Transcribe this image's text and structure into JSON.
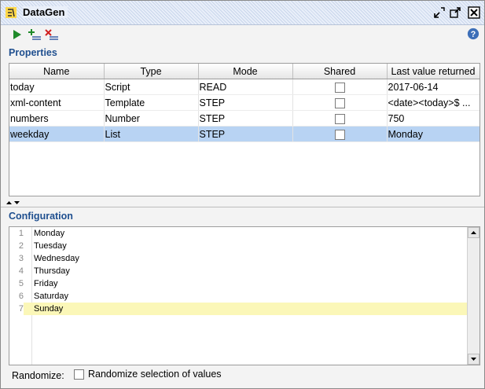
{
  "window": {
    "title": "DataGen"
  },
  "toolbar": {
    "run_icon": "play-icon",
    "add_icon": "add-property-icon",
    "remove_icon": "remove-property-icon",
    "help_icon": "help-icon"
  },
  "properties": {
    "header": "Properties",
    "columns": [
      "Name",
      "Type",
      "Mode",
      "Shared",
      "Last value returned"
    ],
    "rows": [
      {
        "name": "today",
        "type": "Script",
        "mode": "READ",
        "shared": false,
        "last": "2017-06-14"
      },
      {
        "name": "xml-content",
        "type": "Template",
        "mode": "STEP",
        "shared": false,
        "last": "<date><today>$ ..."
      },
      {
        "name": "numbers",
        "type": "Number",
        "mode": "STEP",
        "shared": false,
        "last": "750"
      },
      {
        "name": "weekday",
        "type": "List",
        "mode": "STEP",
        "shared": false,
        "last": "Monday"
      }
    ],
    "selected_row": 3
  },
  "configuration": {
    "header": "Configuration",
    "lines": [
      {
        "num": "1",
        "text": "Monday"
      },
      {
        "num": "2",
        "text": "Tuesday"
      },
      {
        "num": "3",
        "text": "Wednesday"
      },
      {
        "num": "4",
        "text": "Thursday"
      },
      {
        "num": "5",
        "text": "Friday"
      },
      {
        "num": "6",
        "text": "Saturday"
      },
      {
        "num": "7",
        "text": "Sunday"
      }
    ],
    "highlighted_line": 7
  },
  "footer": {
    "randomize_label": "Randomize:",
    "randomize_option": "Randomize selection of values",
    "randomize_checked": false
  },
  "colors": {
    "accent": "#1f4f8f",
    "selection": "#b8d3f3",
    "line_highlight": "#fbf7b8"
  }
}
